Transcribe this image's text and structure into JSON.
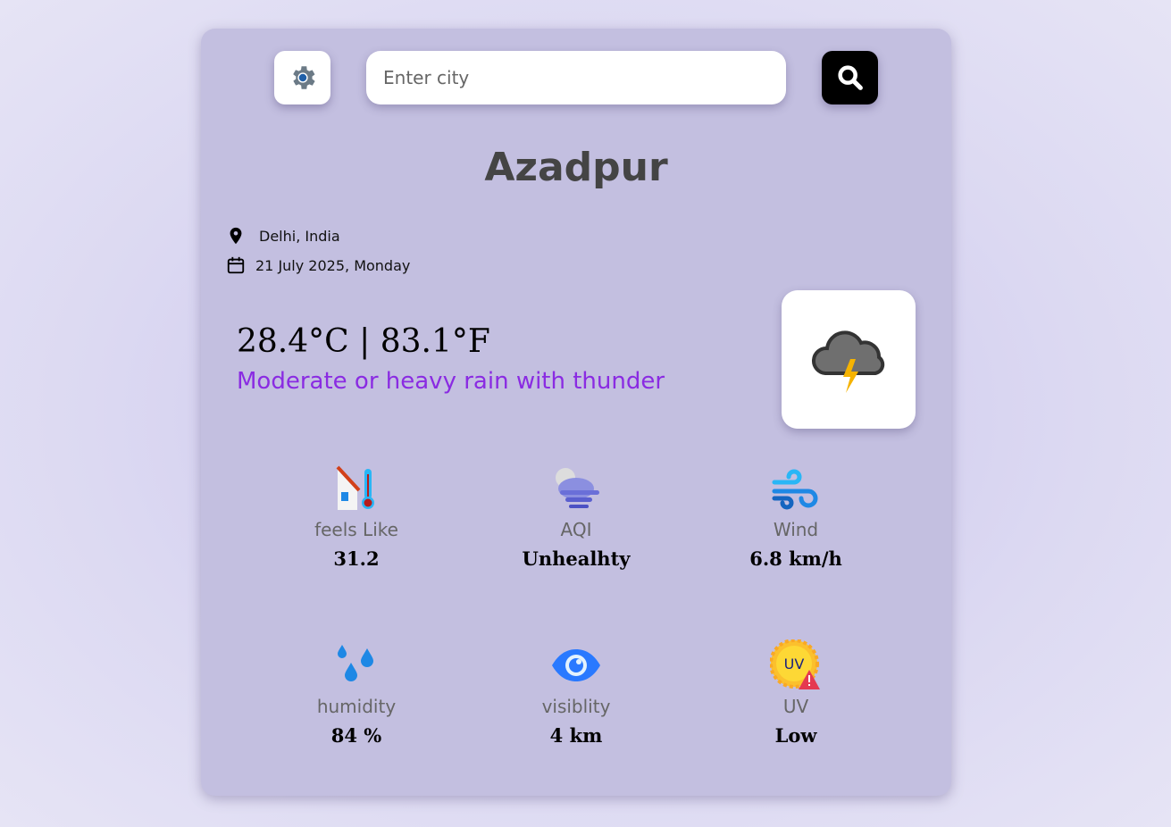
{
  "search": {
    "placeholder": "Enter city"
  },
  "location": {
    "city": "Azadpur",
    "region": "Delhi, India",
    "date": "21 July 2025, Monday"
  },
  "current": {
    "temperature": "28.4°C | 83.1°F",
    "condition": "Moderate or heavy rain with thunder"
  },
  "stats": [
    {
      "label": "feels Like",
      "value": "31.2"
    },
    {
      "label": "AQI",
      "value": "Unhealhty"
    },
    {
      "label": "Wind",
      "value": "6.8 km/h"
    },
    {
      "label": "humidity",
      "value": "84 %"
    },
    {
      "label": "visiblity",
      "value": "4 km"
    },
    {
      "label": "UV",
      "value": "Low",
      "badge": "UV"
    }
  ],
  "colors": {
    "accent": "#8a2be2",
    "card": "#c3bfe0"
  }
}
